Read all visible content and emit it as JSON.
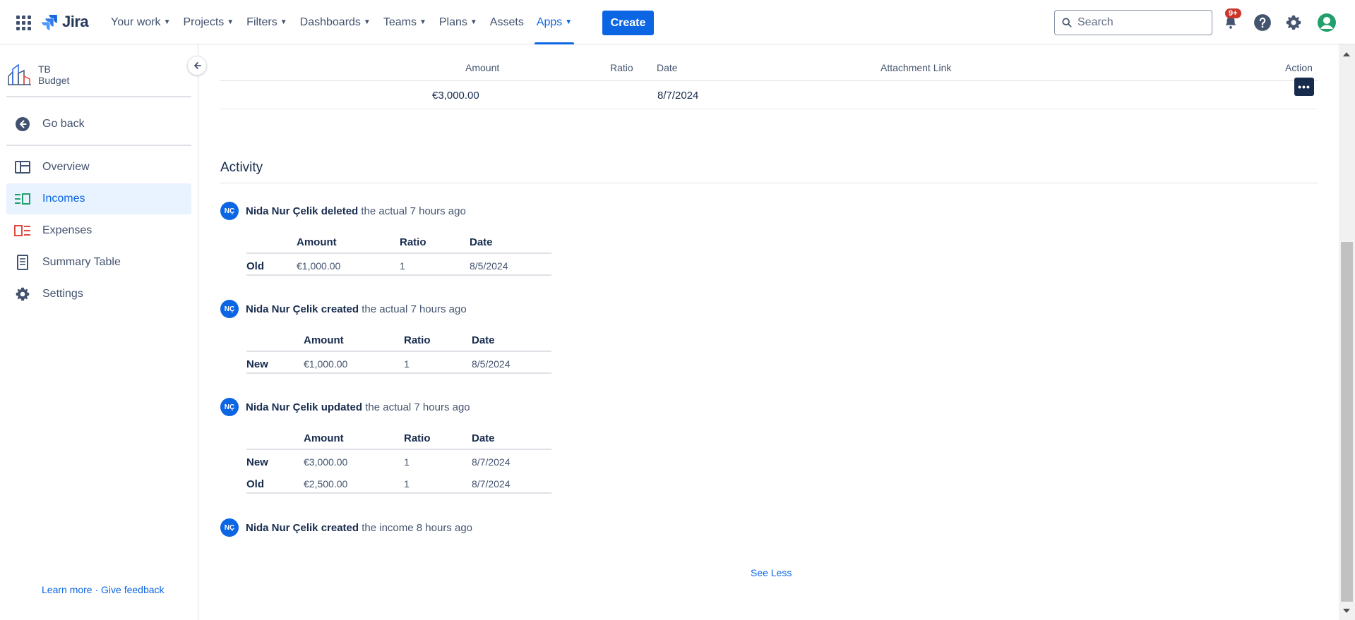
{
  "nav": {
    "logo": "Jira",
    "items": [
      {
        "label": "Your work",
        "chevron": true
      },
      {
        "label": "Projects",
        "chevron": true
      },
      {
        "label": "Filters",
        "chevron": true
      },
      {
        "label": "Dashboards",
        "chevron": true
      },
      {
        "label": "Teams",
        "chevron": true
      },
      {
        "label": "Plans",
        "chevron": true
      },
      {
        "label": "Assets",
        "chevron": false
      },
      {
        "label": "Apps",
        "chevron": true,
        "active": true
      }
    ],
    "create_label": "Create",
    "search_placeholder": "Search",
    "notifications_badge": "9+"
  },
  "sidebar": {
    "project_line1": "TB",
    "project_line2": "Budget",
    "items": [
      {
        "label": "Go back",
        "icon": "arrow-left-circle-icon"
      },
      {
        "label": "Overview",
        "icon": "overview-icon"
      },
      {
        "label": "Incomes",
        "icon": "incomes-icon",
        "active": true
      },
      {
        "label": "Expenses",
        "icon": "expenses-icon"
      },
      {
        "label": "Summary Table",
        "icon": "summary-table-icon"
      },
      {
        "label": "Settings",
        "icon": "gear-icon"
      }
    ],
    "footer": "Learn more · Give feedback"
  },
  "table": {
    "headers": {
      "amount": "Amount",
      "ratio": "Ratio",
      "date": "Date",
      "attachment": "Attachment Link",
      "action": "Action"
    },
    "row": {
      "amount": "€3,000.00",
      "ratio": "",
      "date": "8/7/2024",
      "attachment": ""
    }
  },
  "activity": {
    "title": "Activity",
    "avatar_initials": "NÇ",
    "entries": [
      {
        "actor_action": "Nida Nur Çelik deleted",
        "rest": "the actual 7 hours ago"
      },
      {
        "actor_action": "Nida Nur Çelik created",
        "rest": "the actual 7 hours ago"
      },
      {
        "actor_action": "Nida Nur Çelik updated",
        "rest": "the actual 7 hours ago"
      },
      {
        "actor_action": "Nida Nur Çelik created",
        "rest": "the income 8 hours ago"
      }
    ],
    "tables": [
      {
        "headers": [
          "Amount",
          "Ratio",
          "Date"
        ],
        "rows": [
          {
            "label": "Old",
            "amount": "€1,000.00",
            "ratio": "1",
            "date": "8/5/2024"
          }
        ]
      },
      {
        "headers": [
          "Amount",
          "Ratio",
          "Date"
        ],
        "rows": [
          {
            "label": "New",
            "amount": "€1,000.00",
            "ratio": "1",
            "date": "8/5/2024"
          }
        ]
      },
      {
        "headers": [
          "Amount",
          "Ratio",
          "Date"
        ],
        "rows": [
          {
            "label": "New",
            "amount": "€3,000.00",
            "ratio": "1",
            "date": "8/7/2024"
          },
          {
            "label": "Old",
            "amount": "€2,500.00",
            "ratio": "1",
            "date": "8/7/2024"
          }
        ]
      }
    ],
    "see_less": "See Less"
  },
  "colors": {
    "brand": "#0c66e4",
    "text": "#172b4d",
    "expense": "#e2483d",
    "income": "#22a06b"
  }
}
